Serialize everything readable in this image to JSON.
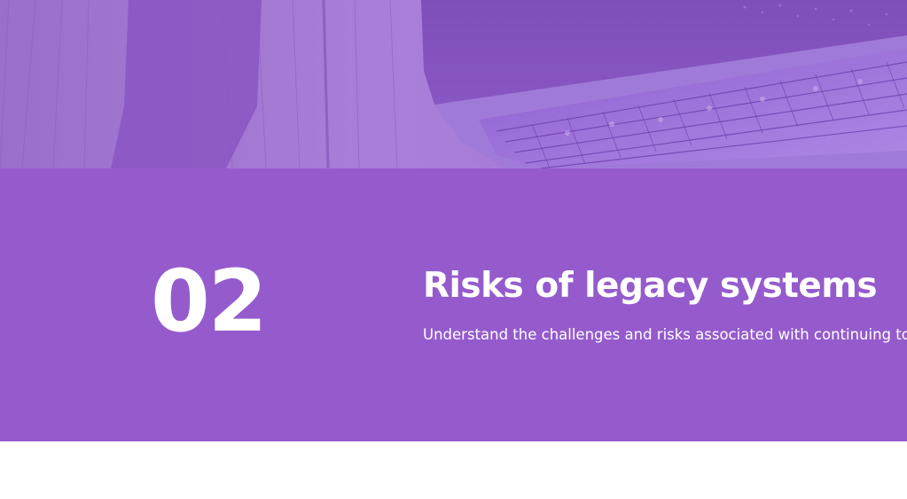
{
  "colors": {
    "band": "#955bcd",
    "hero_tint": "#a67bd6",
    "text": "#ffffff",
    "page_background": "#ffffff"
  },
  "hero": {
    "image_subject": "laptop-on-wooden-desk-photo"
  },
  "section": {
    "number": "02",
    "title": "Risks of legacy systems",
    "description": "Understand the challenges and risks associated with continuing to"
  }
}
